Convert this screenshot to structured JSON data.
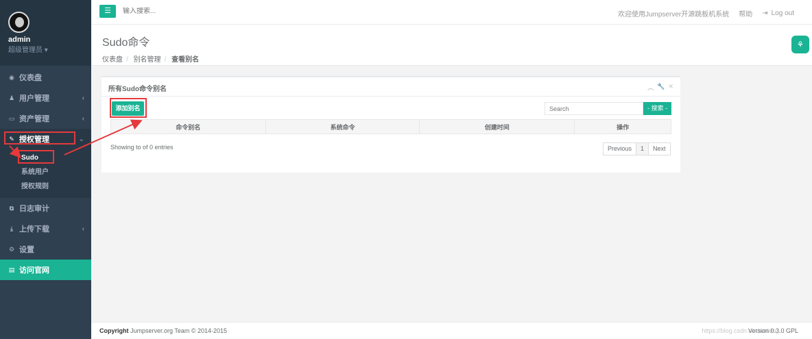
{
  "user": {
    "name": "admin",
    "role": "超级管理员"
  },
  "sidebar": {
    "items": [
      {
        "label": "仪表盘",
        "icon": "dashboard-icon"
      },
      {
        "label": "用户管理",
        "icon": "users-icon"
      },
      {
        "label": "资产管理",
        "icon": "hdd-icon"
      },
      {
        "label": "授权管理",
        "icon": "edit-icon"
      },
      {
        "label": "日志审计",
        "icon": "copy-icon"
      },
      {
        "label": "上传下载",
        "icon": "download-icon"
      },
      {
        "label": "设置",
        "icon": "cogs-icon"
      },
      {
        "label": "访问官网",
        "icon": "file-icon"
      }
    ],
    "subitems": [
      {
        "label": "Sudo"
      },
      {
        "label": "系统用户"
      },
      {
        "label": "授权规则"
      }
    ]
  },
  "topbar": {
    "search_placeholder": "输入搜索...",
    "welcome": "欢迎使用Jumpserver开源跳板机系统",
    "help": "帮助",
    "logout": "Log out"
  },
  "page": {
    "title": "Sudo命令",
    "breadcrumb": [
      "仪表盘",
      "别名管理",
      "查看别名"
    ]
  },
  "panel": {
    "title": "所有Sudo命令别名",
    "add_label": "添加别名",
    "search_placeholder": "Search",
    "search_button": "- 搜索 -",
    "columns": [
      "命令别名",
      "系统命令",
      "创建时间",
      "操作"
    ],
    "info": "Showing to of 0 entries",
    "pager": {
      "previous": "Previous",
      "page": "1",
      "next": "Next"
    }
  },
  "footer": {
    "copyright_label": "Copyright",
    "copyright_text": "Jumpserver.org Team © 2014-2015",
    "version": "Version 0.3.0 GPL",
    "watermark": "https://blog.csdn.net/weixin_..."
  },
  "colors": {
    "accent": "#1ab394",
    "sidebar": "#2f4050",
    "annotation": "#e5393c"
  }
}
